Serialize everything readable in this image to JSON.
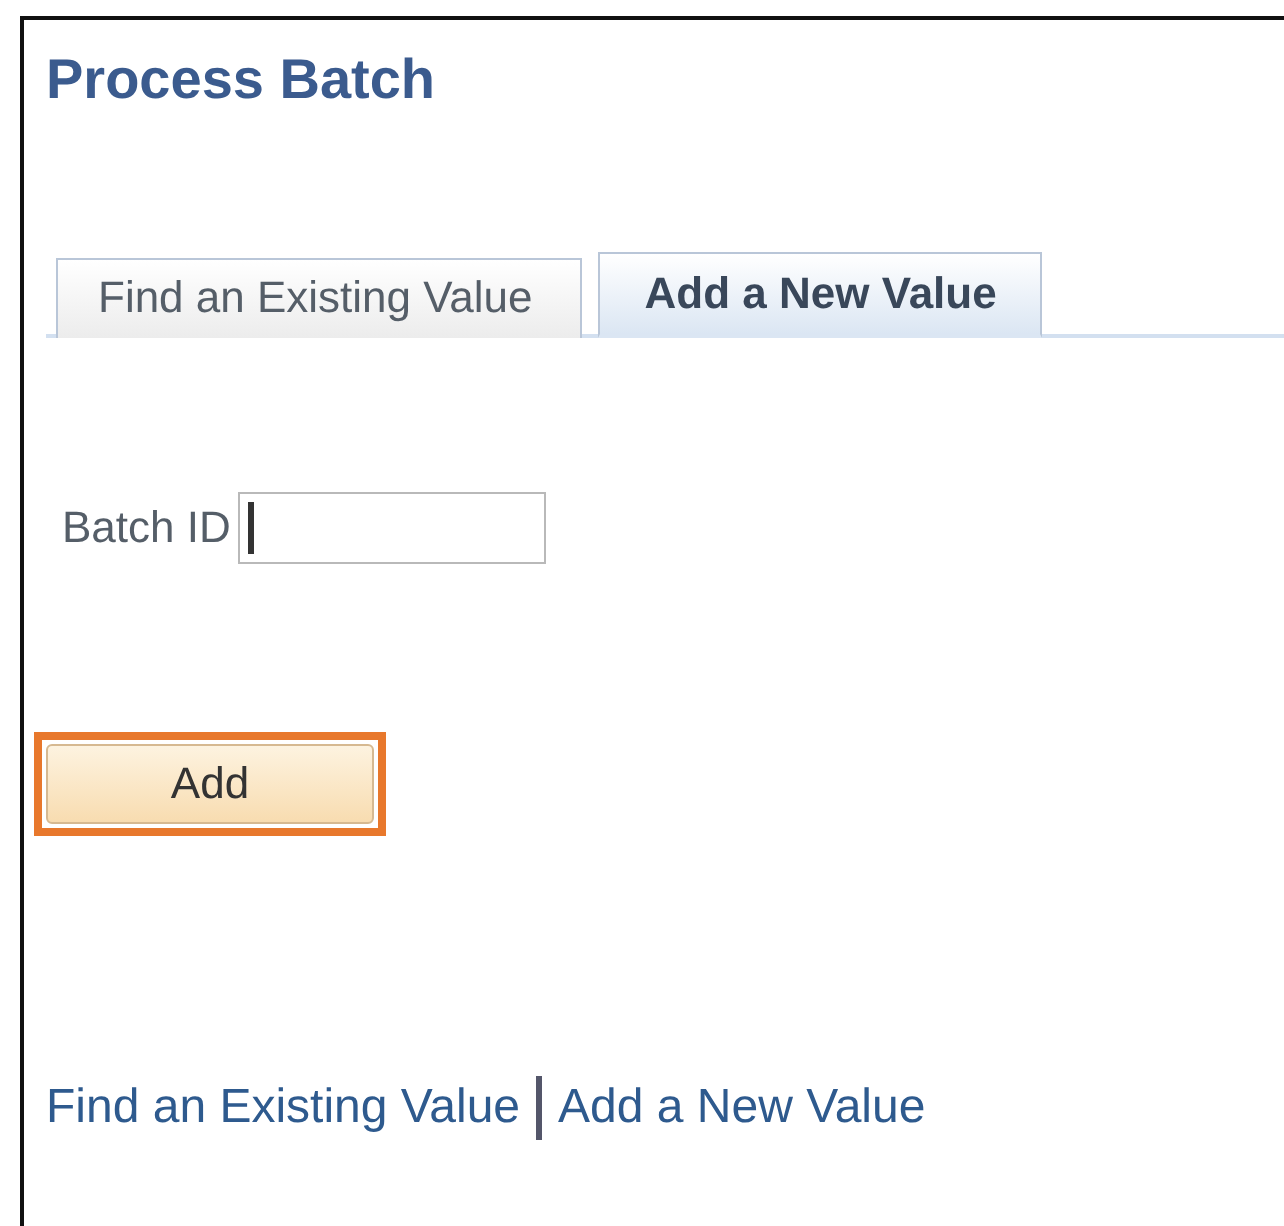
{
  "title": "Process Batch",
  "tabs": [
    {
      "label": "Find an Existing Value",
      "selected": false
    },
    {
      "label": "Add a New Value",
      "selected": true
    }
  ],
  "field": {
    "label": "Batch ID",
    "focused": true
  },
  "button": {
    "label": "Add",
    "highlighted": true
  },
  "footer_links": [
    "Find an Existing Value",
    "Add a New Value"
  ]
}
